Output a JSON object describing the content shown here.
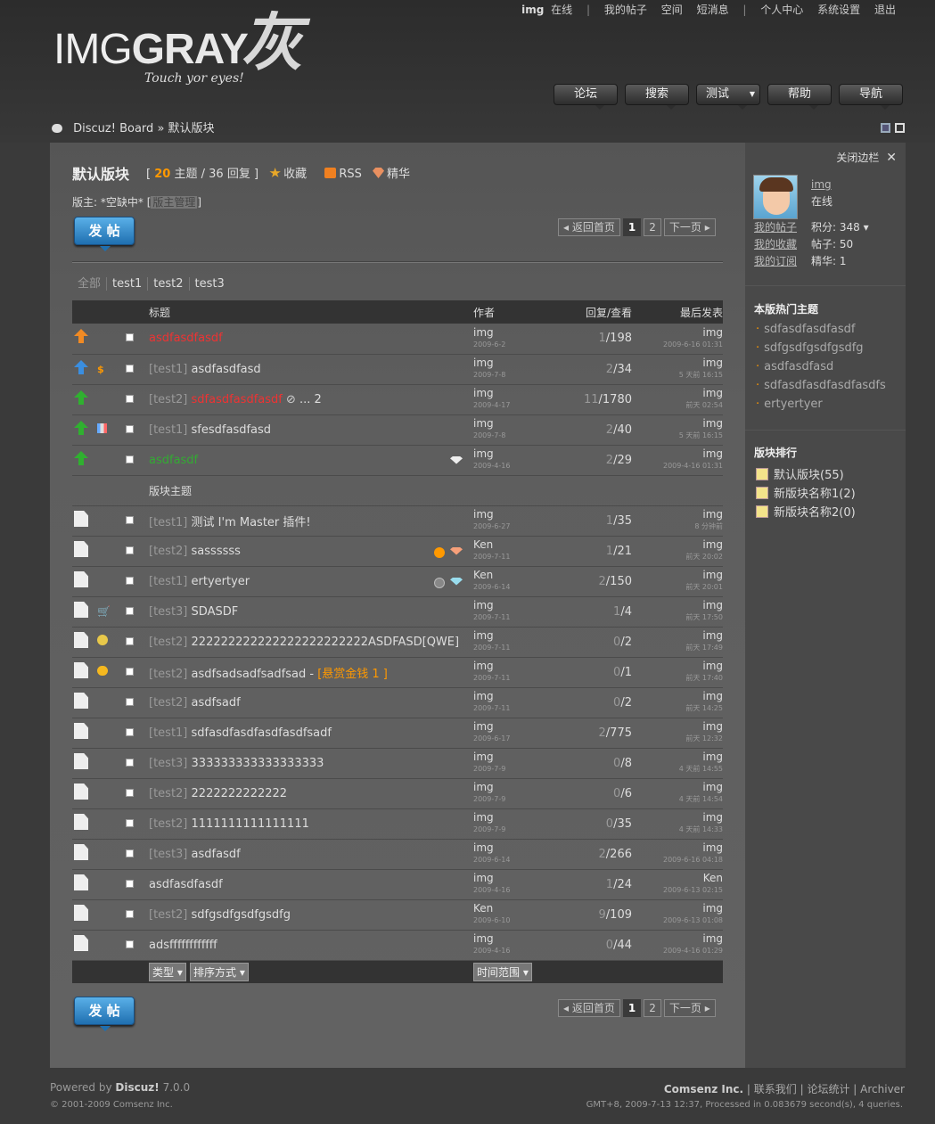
{
  "top": {
    "user": "img",
    "status": "在线",
    "links": [
      "我的帖子",
      "空间",
      "短消息",
      "个人中心",
      "系统设置",
      "退出"
    ]
  },
  "logo": {
    "img": "IMG",
    "gray": "GRAY",
    "cn": "灰",
    "tagline": "Touch yor eyes!"
  },
  "nav": [
    "论坛",
    "搜索",
    "测试",
    "帮助",
    "导航"
  ],
  "breadcrumb": {
    "home": "Discuz! Board",
    "sep": "»",
    "current": "默认版块"
  },
  "forum": {
    "title": "默认版块",
    "threads": "20",
    "threads_label": "主题",
    "replies": "36",
    "replies_label": "回复",
    "fav": "收藏",
    "rss": "RSS",
    "digest": "精华",
    "moderator_label": "版主:",
    "moderator": "*空缺中*",
    "apply": "版主管理"
  },
  "post_button": "发 帖",
  "pager": {
    "back": "返回首页",
    "p1": "1",
    "p2": "2",
    "next": "下一页"
  },
  "types": [
    "全部",
    "test1",
    "test2",
    "test3"
  ],
  "columns": {
    "title": "标题",
    "author": "作者",
    "stats": "回复/查看",
    "last": "最后发表"
  },
  "section_label": "版块主题",
  "sticky": [
    {
      "prefix": "",
      "title": "asdfasdfasdf",
      "cls": "red",
      "author": "img",
      "date": "2009-6-2",
      "r": "1",
      "v": "198",
      "lu": "img",
      "lt": "2009-6-16 01:31",
      "icon": "orange",
      "sub": ""
    },
    {
      "prefix": "[test1]",
      "title": "asdfasdfasd",
      "cls": "",
      "author": "img",
      "date": "2009-7-8",
      "r": "2",
      "v": "34",
      "lu": "img",
      "lt": "5 天前 16:15",
      "icon": "blue",
      "sub": "$"
    },
    {
      "prefix": "[test2]",
      "title": "sdfasdfasdfasdf",
      "cls": "red",
      "author": "img",
      "date": "2009-4-17",
      "r": "11",
      "v": "1780",
      "lu": "img",
      "lt": "前天 02:54",
      "icon": "green",
      "sub": "",
      "extra": "... 2"
    },
    {
      "prefix": "[test1]",
      "title": "sfesdfasdfasd",
      "cls": "",
      "author": "img",
      "date": "2009-7-8",
      "r": "2",
      "v": "40",
      "lu": "img",
      "lt": "5 天前 16:15",
      "icon": "green",
      "sub": "poll"
    },
    {
      "prefix": "",
      "title": "asdfasdf",
      "cls": "green",
      "author": "img",
      "date": "2009-4-16",
      "r": "2",
      "v": "29",
      "lu": "img",
      "lt": "2009-4-16 01:31",
      "icon": "green",
      "sub": ""
    }
  ],
  "normal": [
    {
      "prefix": "[test1]",
      "title": "测试  I'm Master 插件!",
      "author": "img",
      "date": "2009-6-27",
      "r": "1",
      "v": "35",
      "lu": "img",
      "lt": "8 分钟前",
      "sub": ""
    },
    {
      "prefix": "[test2]",
      "title": "sassssss",
      "author": "Ken",
      "date": "2009-7-11",
      "r": "1",
      "v": "21",
      "lu": "img",
      "lt": "前天 20:02",
      "sub": ""
    },
    {
      "prefix": "[test1]",
      "title": "ertyertyer",
      "author": "Ken",
      "date": "2009-6-14",
      "r": "2",
      "v": "150",
      "lu": "img",
      "lt": "前天 20:01",
      "sub": ""
    },
    {
      "prefix": "[test3]",
      "title": "SDASDF",
      "author": "img",
      "date": "2009-7-11",
      "r": "1",
      "v": "4",
      "lu": "img",
      "lt": "前天 17:50",
      "sub": "cart"
    },
    {
      "prefix": "[test2]",
      "title": "222222222222222222222222ASDFASD[QWE]",
      "author": "img",
      "date": "2009-7-11",
      "r": "0",
      "v": "2",
      "lu": "img",
      "lt": "前天 17:49",
      "sub": "people"
    },
    {
      "prefix": "[test2]",
      "title": "asdfsadsadfsadfsad - ",
      "reward": "[悬赏金钱  1 ]",
      "author": "img",
      "date": "2009-7-11",
      "r": "0",
      "v": "1",
      "lu": "img",
      "lt": "前天 17:40",
      "sub": "coin"
    },
    {
      "prefix": "[test2]",
      "title": "asdfsadf",
      "author": "img",
      "date": "2009-7-11",
      "r": "0",
      "v": "2",
      "lu": "img",
      "lt": "前天 14:25",
      "sub": ""
    },
    {
      "prefix": "[test1]",
      "title": "sdfasdfasdfasdfasdfsadf",
      "author": "img",
      "date": "2009-6-17",
      "r": "2",
      "v": "775",
      "lu": "img",
      "lt": "前天 12:32",
      "sub": ""
    },
    {
      "prefix": "[test3]",
      "title": "333333333333333333",
      "author": "img",
      "date": "2009-7-9",
      "r": "0",
      "v": "8",
      "lu": "img",
      "lt": "4 天前 14:55",
      "sub": ""
    },
    {
      "prefix": "[test2]",
      "title": "2222222222222",
      "author": "img",
      "date": "2009-7-9",
      "r": "0",
      "v": "6",
      "lu": "img",
      "lt": "4 天前 14:54",
      "sub": ""
    },
    {
      "prefix": "[test2]",
      "title": "1111111111111111",
      "author": "img",
      "date": "2009-7-9",
      "r": "0",
      "v": "35",
      "lu": "img",
      "lt": "4 天前 14:33",
      "sub": ""
    },
    {
      "prefix": "[test3]",
      "title": "asdfasdf",
      "author": "img",
      "date": "2009-6-14",
      "r": "2",
      "v": "266",
      "lu": "img",
      "lt": "2009-6-16 04:18",
      "sub": ""
    },
    {
      "prefix": "",
      "title": "asdfasdfasdf",
      "author": "img",
      "date": "2009-4-16",
      "r": "1",
      "v": "24",
      "lu": "Ken",
      "lt": "2009-6-13 02:15",
      "sub": ""
    },
    {
      "prefix": "[test2]",
      "title": "sdfgsdfgsdfgsdfg",
      "author": "Ken",
      "date": "2009-6-10",
      "r": "9",
      "v": "109",
      "lu": "img",
      "lt": "2009-6-13 01:08",
      "sub": ""
    },
    {
      "prefix": "",
      "title": "adsffffffffffff",
      "author": "img",
      "date": "2009-4-16",
      "r": "0",
      "v": "44",
      "lu": "img",
      "lt": "2009-4-16 01:29",
      "sub": ""
    }
  ],
  "filters": {
    "type": "类型",
    "order": "排序方式",
    "range": "时间范围"
  },
  "sidebar": {
    "close": "关闭边栏",
    "user": "img",
    "status": "在线",
    "links": [
      "我的帖子",
      "我的收藏",
      "我的订阅"
    ],
    "points_label": "积分:",
    "points": "348",
    "posts_label": "帖子:",
    "posts": "50",
    "digest_label": "精华:",
    "digest": "1",
    "hot_title": "本版热门主题",
    "hot": [
      "sdfasdfasdfasdf",
      "sdfgsdfgsdfgsdfg",
      "asdfasdfasd",
      "sdfasdfasdfasdfasdfs",
      "ertyertyer"
    ],
    "rank_title": "版块排行",
    "ranks": [
      "默认版块(55)",
      "新版块名称1(2)",
      "新版块名称2(0)"
    ]
  },
  "footer": {
    "powered": "Powered by",
    "discuz": "Discuz!",
    "version": "7.0.0",
    "copy": "© 2001-2009 Comsenz Inc.",
    "company": "Comsenz Inc.",
    "links": [
      "联系我们",
      "论坛统计",
      "Archiver"
    ],
    "info": "GMT+8, 2009-7-13 12:37, Processed in 0.083679 second(s), 4 queries."
  },
  "colors": {
    "accent": "#ff9900",
    "red": "#ee3333",
    "green": "#33aa33"
  }
}
